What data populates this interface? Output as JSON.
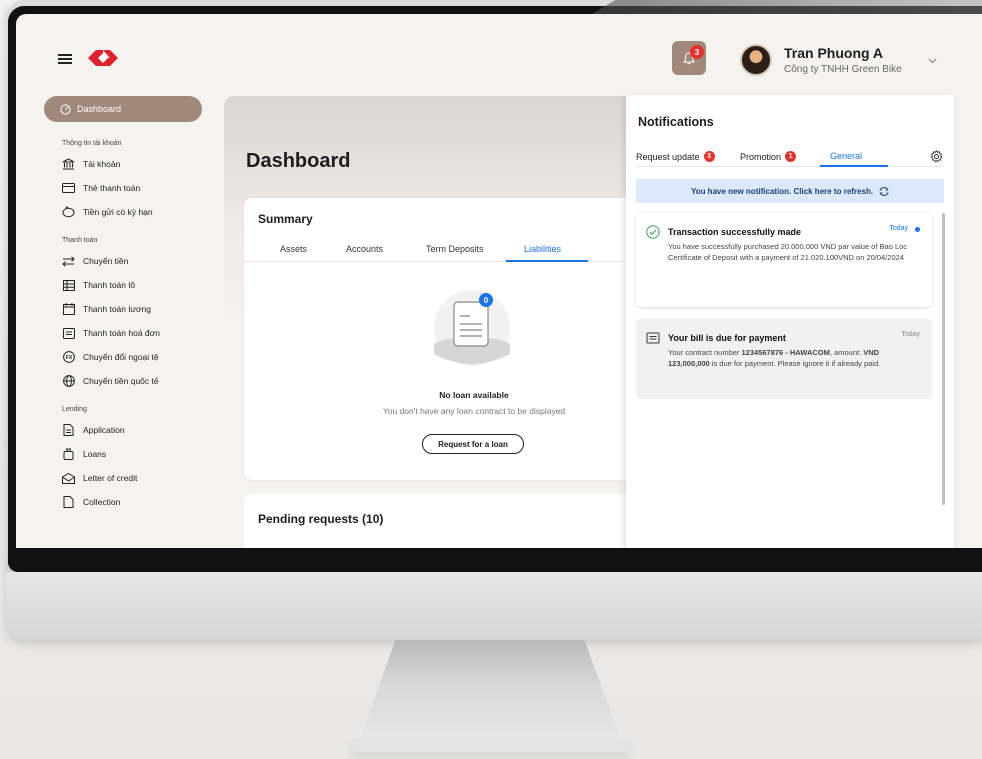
{
  "header": {
    "notification_count": "3",
    "user_name": "Tran Phuong A",
    "company": "Công ty TNHH Green Bike"
  },
  "sidebar": {
    "active_label": "Dashboard",
    "sections": [
      {
        "title": "Thông tin tài khoản",
        "items": [
          "Tài khoản",
          "Thẻ thanh toán",
          "Tiền gửi có kỳ hạn"
        ]
      },
      {
        "title": "Thanh toán",
        "items": [
          "Chuyển tiền",
          "Thanh toán lô",
          "Thanh toán lương",
          "Thanh toán hoá đơn",
          "Chuyển đổi ngoại tệ",
          "Chuyển tiền quốc tế"
        ]
      },
      {
        "title": "Lending",
        "items": [
          "Application",
          "Loans",
          "Letter of credit",
          "Collection"
        ]
      }
    ]
  },
  "main": {
    "title": "Dashboard",
    "summary": {
      "title": "Summary",
      "tabs": [
        "Assets",
        "Accounts",
        "Term Deposits",
        "Liabilities"
      ],
      "active_tab": "Liabilities",
      "empty_badge": "0",
      "empty_title": "No loan available",
      "empty_subtitle": "You don't have any loan contract to be displayed",
      "request_button": "Request for a loan"
    },
    "pending_title": "Pending requests (10)"
  },
  "notifications": {
    "title": "Notifications",
    "tabs": [
      {
        "label": "Request update",
        "badge": "3"
      },
      {
        "label": "Promotion",
        "badge": "1"
      },
      {
        "label": "General",
        "badge": ""
      }
    ],
    "refresh_text": "You have new notification. Click here to refresh.",
    "items": [
      {
        "title": "Transaction successfully made",
        "date": "Today",
        "body": "You have successfully purchased 20.000.000 VND par value of Bao Loc Certificate of Deposit with a payment of 21.020.100VND on 20/04/2024",
        "unread": true
      },
      {
        "title": "Your bill is due for payment",
        "date": "Today",
        "body_prefix": "Your contract number ",
        "contract": "1234567876 - HAWACOM",
        "body_mid": ", amount: ",
        "amount": "VND 123,000,000",
        "body_suffix": " is due for payment. Please ignore it if already paid.",
        "unread": false
      }
    ]
  },
  "colors": {
    "brand_accent": "#a0897a",
    "link_blue": "#1a73e8",
    "badge_red": "#e5322c",
    "logo_red": "#e0212d"
  }
}
